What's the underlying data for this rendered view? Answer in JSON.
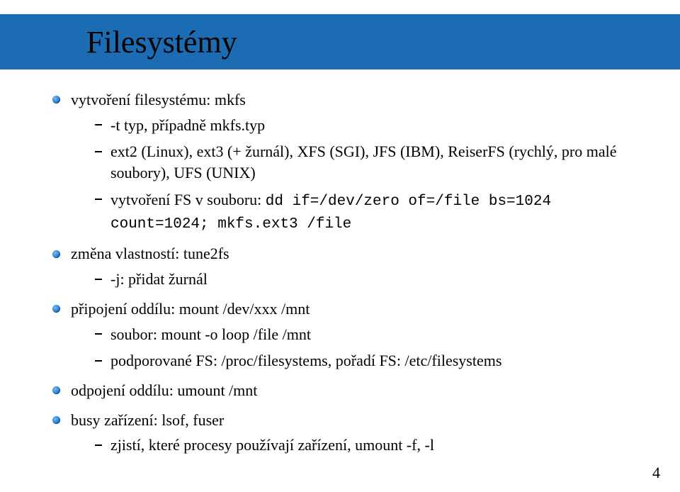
{
  "title": "Filesystémy",
  "page_number": "4",
  "items": [
    {
      "text": "vytvoření filesystému: mkfs",
      "sub": [
        {
          "text": "-t typ, případně mkfs.typ"
        },
        {
          "text": "ext2 (Linux), ext3 (+ žurnál), XFS (SGI), JFS (IBM), ReiserFS (rychlý, pro malé soubory), UFS (UNIX)"
        },
        {
          "text_prefix": "vytvoření FS v souboru: ",
          "mono": "dd if=/dev/zero of=/file bs=1024 count=1024; mkfs.ext3 /file"
        }
      ]
    },
    {
      "text": "změna vlastností: tune2fs",
      "sub": [
        {
          "text": "-j: přidat žurnál"
        }
      ]
    },
    {
      "text": "připojení oddílu: mount /dev/xxx /mnt",
      "sub": [
        {
          "text": "soubor: mount -o loop /file /mnt"
        },
        {
          "text": "podporované FS: /proc/filesystems, pořadí FS: /etc/filesystems"
        }
      ]
    },
    {
      "text": "odpojení oddílu: umount /mnt"
    },
    {
      "text": "busy zařízení: lsof, fuser",
      "sub": [
        {
          "text": "zjistí, které procesy používají zařízení, umount -f, -l"
        }
      ]
    }
  ]
}
